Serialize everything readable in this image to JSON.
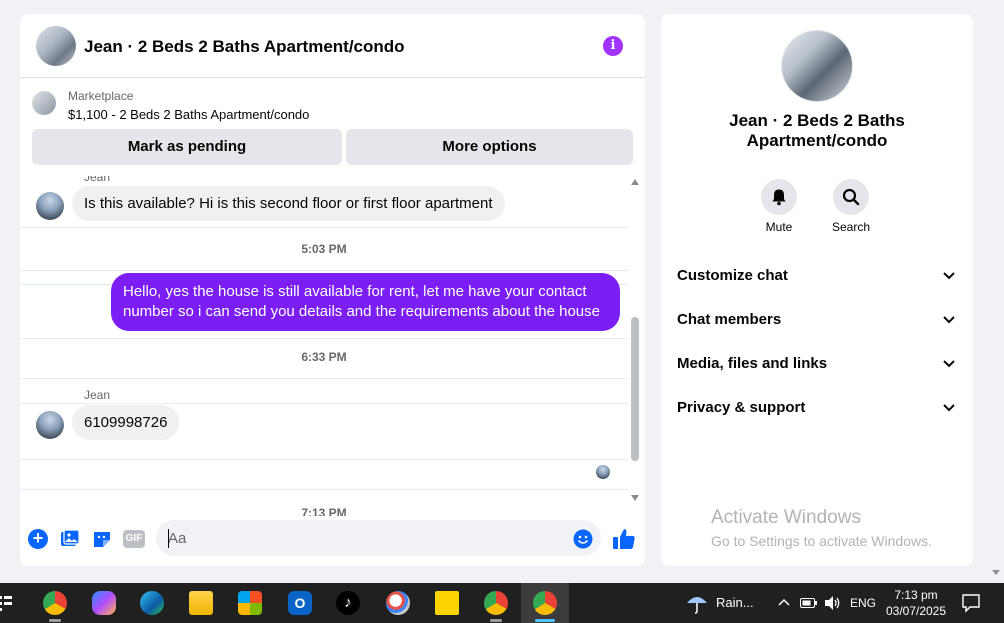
{
  "header": {
    "title": "Jean · 2 Beds 2 Baths Apartment/condo",
    "info_icon": "info-icon"
  },
  "listing": {
    "source": "Marketplace",
    "price_title": "$1,100 - 2 Beds 2 Baths Apartment/condo",
    "buttons": {
      "pending": "Mark as pending",
      "more": "More options"
    }
  },
  "messages": {
    "partial_sender": "Jean",
    "msg1": "Is this available? Hi is this second floor or first floor apartment",
    "time1": "5:03 PM",
    "msg2": "Hello, yes the house is still available for rent, let me have your contact number so i can send you details and the requirements about the house",
    "time2": "6:33 PM",
    "sender2": "Jean",
    "msg3": "6109998726",
    "time3": "7:13 PM"
  },
  "composer": {
    "placeholder": "Aa",
    "gif_label": "GIF"
  },
  "side": {
    "title": "Jean · 2 Beds 2 Baths Apartment/condo",
    "actions": {
      "mute": "Mute",
      "search": "Search"
    },
    "sections": [
      "Customize chat",
      "Chat members",
      "Media, files and links",
      "Privacy & support"
    ]
  },
  "watermark": {
    "title": "Activate Windows",
    "subtitle": "Go to Settings to activate Windows."
  },
  "taskbar": {
    "weather": "Rain...",
    "language": "ENG",
    "time": "7:13 pm",
    "date": "03/07/2025",
    "apps": [
      "chrome-icon",
      "copilot-icon",
      "edge-icon",
      "file-explorer-icon",
      "store-icon",
      "outlook-icon",
      "tiktok-icon",
      "paint-icon",
      "sticky-notes-icon",
      "chrome-icon",
      "chrome-icon"
    ]
  },
  "colors": {
    "outgoing_bubble": "#7a1ef4",
    "accent": "#0866ff",
    "info": "#a033ff"
  }
}
